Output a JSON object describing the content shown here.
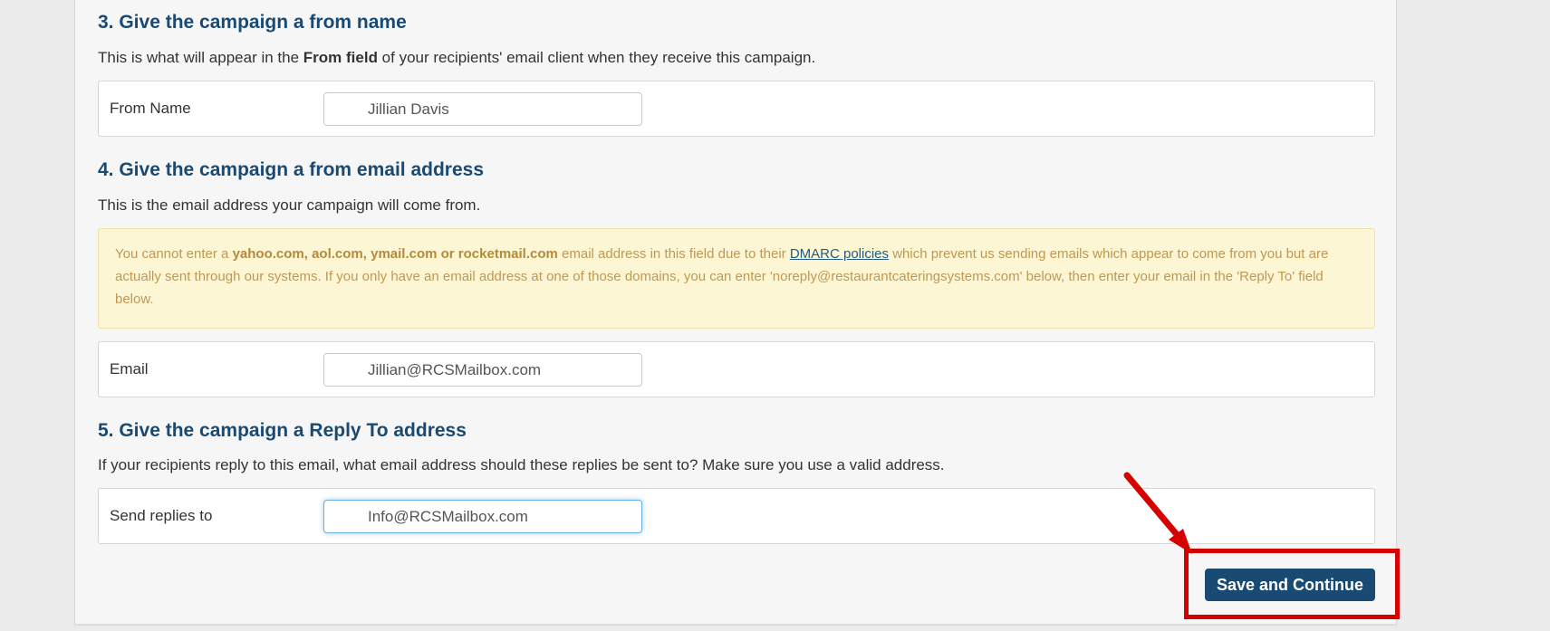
{
  "section3": {
    "heading": "3. Give the campaign a from name",
    "desc_before": "This is what will appear in the ",
    "desc_bold": "From field",
    "desc_after": " of your recipients' email client when they receive this campaign.",
    "field_label": "From Name",
    "field_value": "Jillian Davis"
  },
  "section4": {
    "heading": "4. Give the campaign a from email address",
    "desc": "This is the email address your campaign will come from.",
    "alert": {
      "t1": "You cannot enter a ",
      "b1": "yahoo.com, aol.com, ymail.com or rocketmail.com",
      "t2": " email address in this field due to their ",
      "link": "DMARC policies",
      "t3": " which prevent us sending emails which appear to come from you but are actually sent through our systems. If you only have an email address at one of those domains, you can enter 'noreply@restaurantcateringsystems.com' below, then enter your email in the 'Reply To' field below."
    },
    "field_label": "Email",
    "field_value": "Jillian@RCSMailbox.com"
  },
  "section5": {
    "heading": "5. Give the campaign a Reply To address",
    "desc": "If your recipients reply to this email, what email address should these replies be sent to? Make sure you use a valid address.",
    "field_label": "Send replies to",
    "field_value": "Info@RCSMailbox.com"
  },
  "actions": {
    "save_label": "Save and Continue"
  },
  "colors": {
    "heading": "#184a74",
    "button": "#184a74",
    "alert_bg": "#fcf6d4",
    "alert_text": "#c09853",
    "annotation": "#d70000"
  }
}
